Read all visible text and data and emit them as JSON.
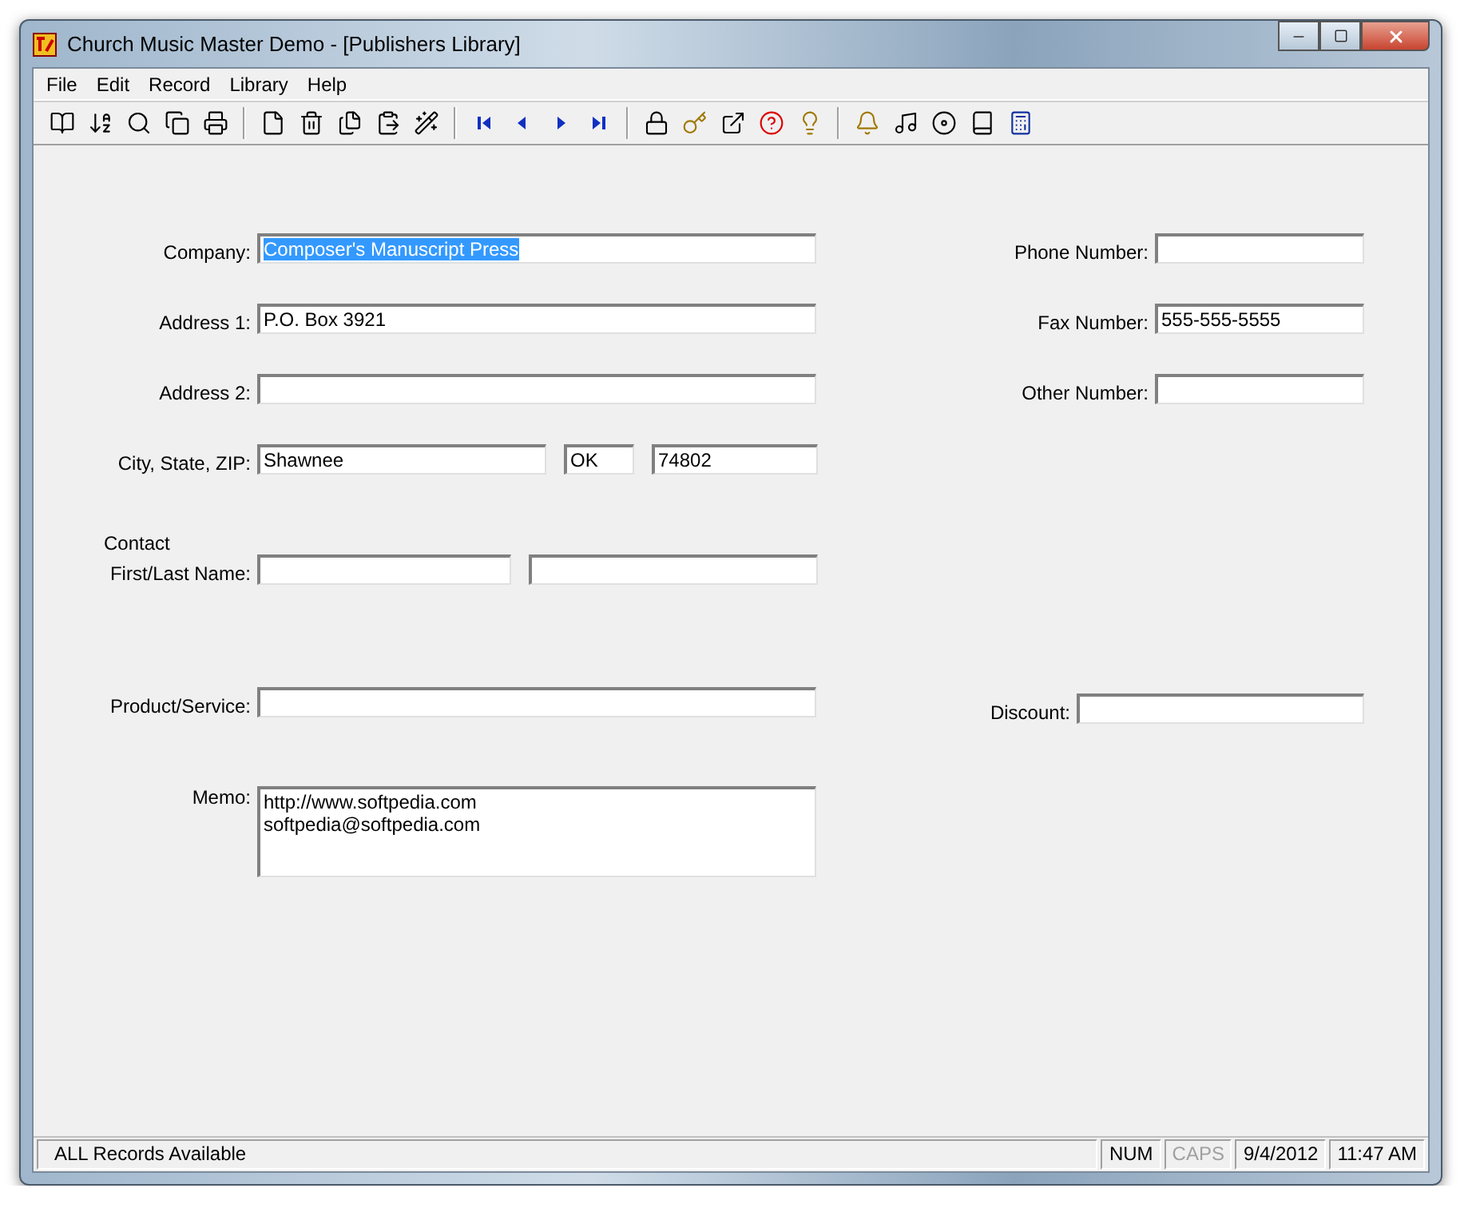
{
  "window": {
    "title": "Church Music Master Demo - [Publishers Library]"
  },
  "menu": [
    "File",
    "Edit",
    "Record",
    "Library",
    "Help"
  ],
  "form": {
    "company": {
      "label": "Company:",
      "value": "Composer's Manuscript Press",
      "selected": true
    },
    "address1": {
      "label": "Address 1:",
      "value": "P.O. Box 3921"
    },
    "address2": {
      "label": "Address 2:"
    },
    "city_state_zip": {
      "label": "City, State, ZIP:",
      "city": "Shawnee",
      "state": "OK",
      "zip": "74802"
    },
    "contact_heading": "Contact",
    "name": {
      "label": "First/Last Name:"
    },
    "product": {
      "label": "Product/Service:"
    },
    "memo": {
      "label": "Memo:",
      "lines": [
        "http://www.softpedia.com",
        "softpedia@softpedia.com"
      ]
    },
    "phone": {
      "label": "Phone Number:"
    },
    "fax": {
      "label": "Fax Number:",
      "value": "555-555-5555"
    },
    "other": {
      "label": "Other Number:"
    },
    "discount": {
      "label": "Discount:"
    }
  },
  "status_bar": {
    "message": "ALL Records Available",
    "indicators": [
      {
        "label": "NUM",
        "disabled": false
      },
      {
        "label": "CAPS",
        "disabled": true
      },
      {
        "label": "9/4/2012",
        "disabled": false
      },
      {
        "label": "11:47 AM",
        "disabled": false
      }
    ]
  }
}
